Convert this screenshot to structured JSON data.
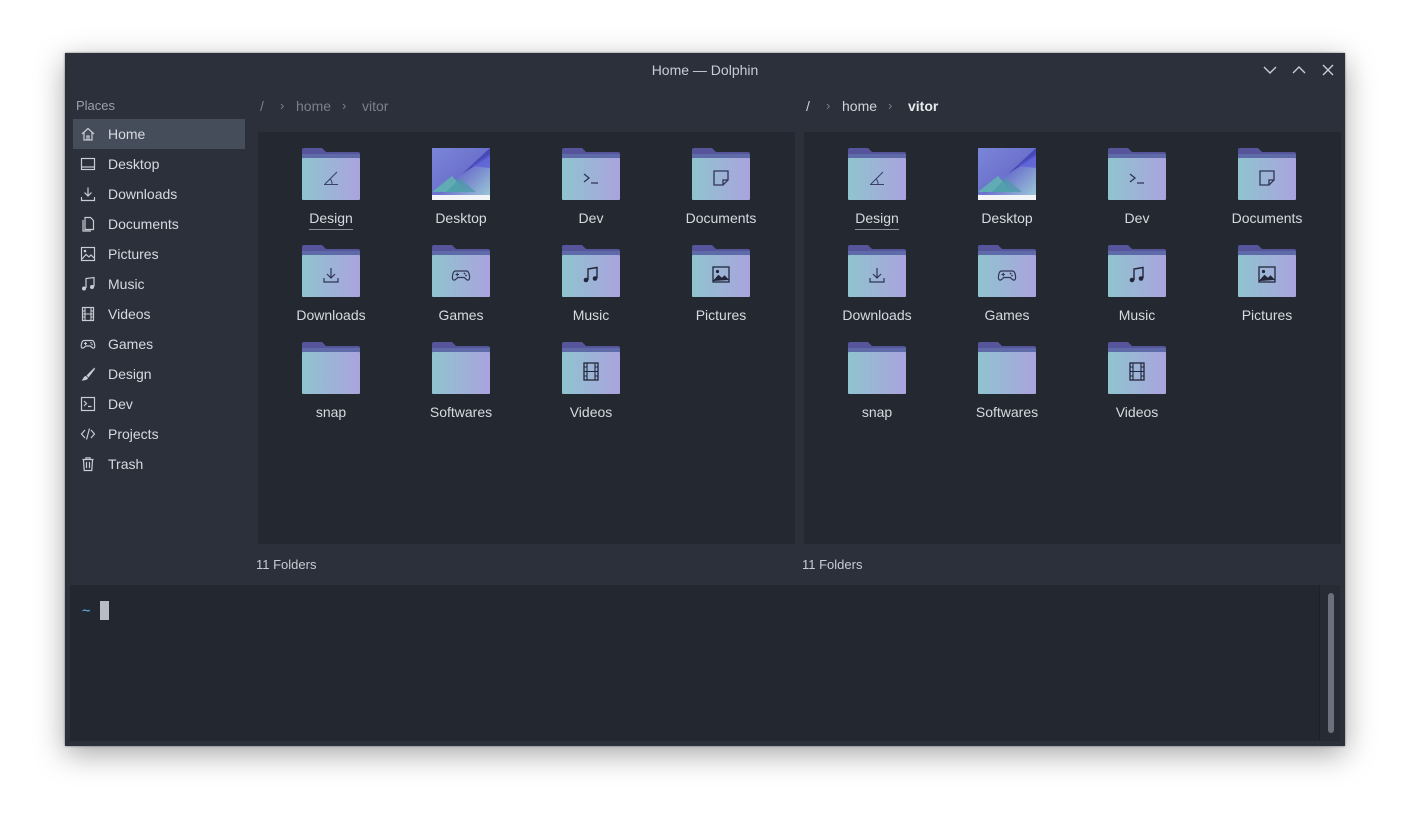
{
  "window": {
    "title": "Home — Dolphin"
  },
  "titlebar_buttons": [
    {
      "name": "minimize-button",
      "icon": "chevron-down-icon"
    },
    {
      "name": "maximize-button",
      "icon": "chevron-up-icon"
    },
    {
      "name": "close-button",
      "icon": "close-icon"
    }
  ],
  "sidebar": {
    "heading": "Places",
    "items": [
      {
        "label": "Home",
        "icon": "home-icon",
        "active": true
      },
      {
        "label": "Desktop",
        "icon": "desktop-icon"
      },
      {
        "label": "Downloads",
        "icon": "download-icon"
      },
      {
        "label": "Documents",
        "icon": "documents-icon"
      },
      {
        "label": "Pictures",
        "icon": "picture-icon"
      },
      {
        "label": "Music",
        "icon": "music-icon"
      },
      {
        "label": "Videos",
        "icon": "film-icon"
      },
      {
        "label": "Games",
        "icon": "gamepad-icon"
      },
      {
        "label": "Design",
        "icon": "brush-icon"
      },
      {
        "label": "Dev",
        "icon": "terminal-icon"
      },
      {
        "label": "Projects",
        "icon": "code-icon"
      },
      {
        "label": "Trash",
        "icon": "trash-icon"
      }
    ]
  },
  "panes": [
    {
      "breadcrumb": {
        "root": "/",
        "parts": [
          "home",
          "vitor"
        ]
      },
      "status": "11 Folders",
      "folders": [
        {
          "label": "Design",
          "emblem": "design"
        },
        {
          "label": "Desktop",
          "emblem": "desktop"
        },
        {
          "label": "Dev",
          "emblem": "terminal"
        },
        {
          "label": "Documents",
          "emblem": "document"
        },
        {
          "label": "Downloads",
          "emblem": "download"
        },
        {
          "label": "Games",
          "emblem": "gamepad"
        },
        {
          "label": "Music",
          "emblem": "music"
        },
        {
          "label": "Pictures",
          "emblem": "picture"
        },
        {
          "label": "snap",
          "emblem": "none"
        },
        {
          "label": "Softwares",
          "emblem": "none"
        },
        {
          "label": "Videos",
          "emblem": "film"
        }
      ]
    },
    {
      "breadcrumb": {
        "root": "/",
        "parts": [
          "home",
          "vitor"
        ]
      },
      "status": "11 Folders",
      "folders": [
        {
          "label": "Design",
          "emblem": "design"
        },
        {
          "label": "Desktop",
          "emblem": "desktop"
        },
        {
          "label": "Dev",
          "emblem": "terminal"
        },
        {
          "label": "Documents",
          "emblem": "document"
        },
        {
          "label": "Downloads",
          "emblem": "download"
        },
        {
          "label": "Games",
          "emblem": "gamepad"
        },
        {
          "label": "Music",
          "emblem": "music"
        },
        {
          "label": "Pictures",
          "emblem": "picture"
        },
        {
          "label": "snap",
          "emblem": "none"
        },
        {
          "label": "Softwares",
          "emblem": "none"
        },
        {
          "label": "Videos",
          "emblem": "film"
        }
      ]
    }
  ],
  "terminal": {
    "prompt": "~"
  },
  "colors": {
    "window_bg": "#2b303b",
    "view_bg": "#242831",
    "active_place": "#454c5a",
    "folder_teal": "#8fc4cf",
    "folder_lavender": "#a9a3dc",
    "folder_back": "#5b5a9c",
    "prompt": "#5fb0e8"
  }
}
